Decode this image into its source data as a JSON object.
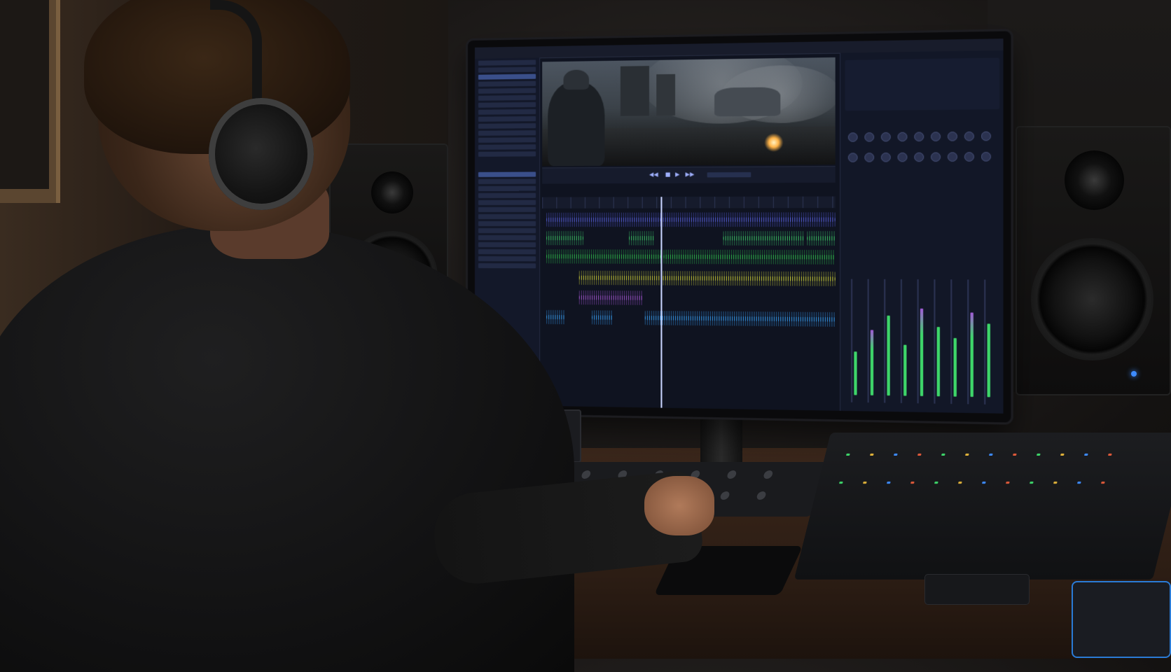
{
  "scene": {
    "subject": "person-with-headphones",
    "setting": "audio-post-production-studio"
  },
  "daw": {
    "menu": [
      "",
      "",
      "",
      "",
      ""
    ],
    "clip_colors": [
      "#5b63e6",
      "#3fd06a",
      "#31c94f",
      "#d6d83a",
      "#b05be0",
      "#3aa6ff"
    ],
    "meter_colors": [
      "#3ed66a",
      "#a35bd9"
    ],
    "accent": "#3d8bff"
  },
  "icons": {
    "play": "play-icon",
    "stop": "stop-icon",
    "rewind": "rewind-icon",
    "forward": "forward-icon",
    "speaker_led": "power-led-icon"
  },
  "colors": {
    "speaker_led": "#3d8bff",
    "interface_ring": "#3ab85a",
    "dock_accent": "#2a7bd6"
  }
}
